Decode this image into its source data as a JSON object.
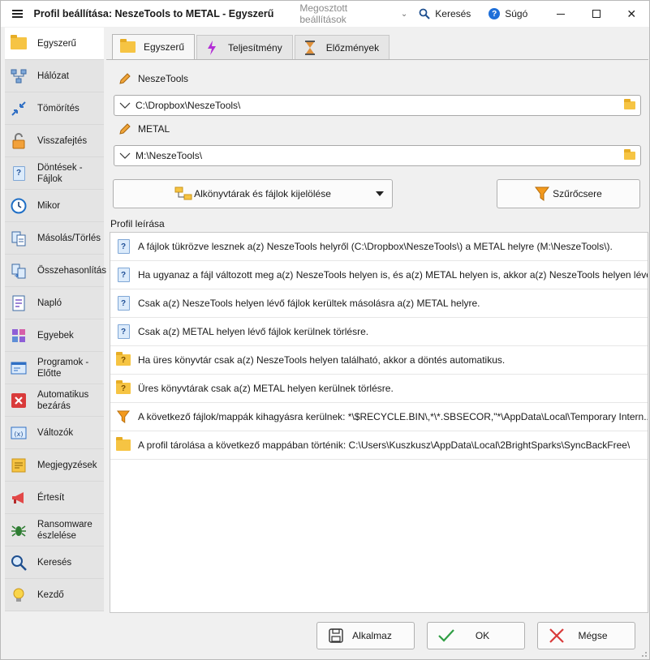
{
  "window": {
    "title": "Profil beállítása: NeszeTools to METAL - Egyszerű",
    "shared_settings": "Megosztott beállítások",
    "search": "Keresés",
    "help": "Súgó"
  },
  "sidebar": {
    "items": [
      {
        "label": "Egyszerű",
        "icon": "folder-icon",
        "active": true
      },
      {
        "label": "Hálózat",
        "icon": "network-icon"
      },
      {
        "label": "Tömörítés",
        "icon": "compress-icon"
      },
      {
        "label": "Visszafejtés",
        "icon": "unlock-icon"
      },
      {
        "label": "Döntések - Fájlok",
        "icon": "decision-icon"
      },
      {
        "label": "Mikor",
        "icon": "clock-icon"
      },
      {
        "label": "Másolás/Törlés",
        "icon": "copy-delete-icon"
      },
      {
        "label": "Összehasonlítás",
        "icon": "compare-icon"
      },
      {
        "label": "Napló",
        "icon": "log-icon"
      },
      {
        "label": "Egyebek",
        "icon": "misc-icon"
      },
      {
        "label": "Programok - Előtte",
        "icon": "programs-icon"
      },
      {
        "label": "Automatikus bezárás",
        "icon": "auto-close-icon"
      },
      {
        "label": "Változók",
        "icon": "variables-icon"
      },
      {
        "label": "Megjegyzések",
        "icon": "notes-icon"
      },
      {
        "label": "Értesít",
        "icon": "notify-icon"
      },
      {
        "label": "Ransomware észlelése",
        "icon": "ransomware-icon"
      },
      {
        "label": "Keresés",
        "icon": "search-icon"
      },
      {
        "label": "Kezdő",
        "icon": "lightbulb-icon"
      }
    ]
  },
  "tabs": [
    {
      "label": "Egyszerű",
      "active": true
    },
    {
      "label": "Teljesítmény"
    },
    {
      "label": "Előzmények"
    }
  ],
  "source": {
    "label": "NeszeTools",
    "path": "C:\\Dropbox\\NeszeTools\\"
  },
  "destination": {
    "label": "METAL",
    "path": "M:\\NeszeTools\\"
  },
  "buttons": {
    "subfolders": "Alkönyvtárak és fájlok kijelölése",
    "filter": "Szűrőcsere"
  },
  "description": {
    "label": "Profil leírása",
    "rows": [
      {
        "icon": "doc",
        "text": "A fájlok tükrözve lesznek a(z) NeszeTools helyről (C:\\Dropbox\\NeszeTools\\) a METAL helyre (M:\\NeszeTools\\)."
      },
      {
        "icon": "doc",
        "text": "Ha ugyanaz a fájl változott meg a(z) NeszeTools helyen is, és a(z) METAL helyen is, akkor a(z) NeszeTools helyen lévő f..."
      },
      {
        "icon": "doc",
        "text": "Csak a(z) NeszeTools helyen lévő fájlok kerültek másolásra a(z) METAL helyre."
      },
      {
        "icon": "doc",
        "text": "Csak a(z) METAL helyen lévő fájlok kerülnek törlésre."
      },
      {
        "icon": "folderq",
        "text": "Ha üres könyvtár csak a(z) NeszeTools helyen található, akkor a döntés automatikus."
      },
      {
        "icon": "folderq",
        "text": "Üres könyvtárak csak a(z) METAL helyen kerülnek törlésre."
      },
      {
        "icon": "filter",
        "text": "A következő fájlok/mappák kihagyásra kerülnek: *\\$RECYCLE.BIN\\,*\\*.SBSECOR,\"*\\AppData\\Local\\Temporary Intern..."
      },
      {
        "icon": "folder",
        "text": "A profil tárolása a következő mappában történik: C:\\Users\\Kuszkusz\\AppData\\Local\\2BrightSparks\\SyncBackFree\\"
      }
    ]
  },
  "footer": {
    "apply": "Alkalmaz",
    "ok": "OK",
    "cancel": "Mégse"
  },
  "colors": {
    "accent_blue": "#1e6fd9",
    "folder_yellow": "#f6c443",
    "ok_green": "#2f9e44",
    "cancel_red": "#d93a3a"
  }
}
